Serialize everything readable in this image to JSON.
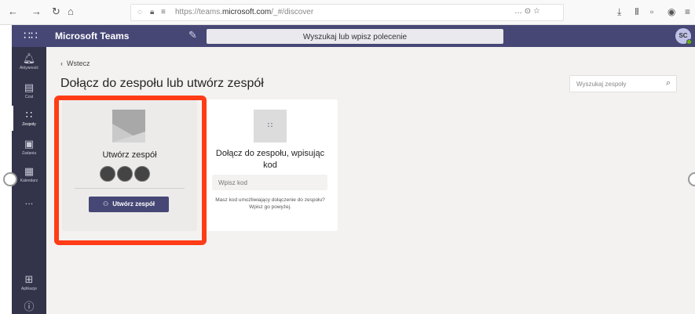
{
  "browser": {
    "url_prefix": "https://teams.",
    "url_domain": "microsoft.com",
    "url_suffix": "/_#/discover",
    "more_label": "… ⊙ ☆"
  },
  "header": {
    "app_name": "Microsoft Teams",
    "search_placeholder": "Wyszukaj lub wpisz polecenie",
    "avatar_initials": "SC"
  },
  "rail": {
    "items": [
      {
        "label": "Aktywność",
        "icon": "bell-icon"
      },
      {
        "label": "Czat",
        "icon": "chat-icon"
      },
      {
        "label": "Zespoły",
        "icon": "teams-icon"
      },
      {
        "label": "Zadania",
        "icon": "tasks-icon"
      },
      {
        "label": "Kalendarz",
        "icon": "calendar-icon"
      },
      {
        "label": "...",
        "icon": "more-icon"
      },
      {
        "label": "Aplikacje",
        "icon": "apps-icon"
      },
      {
        "label": "",
        "icon": "help-icon"
      }
    ]
  },
  "main": {
    "back_label": "Wstecz",
    "title": "Dołącz do zespołu lub utwórz zespół",
    "team_search_placeholder": "Wyszukaj zespoły",
    "create_card": {
      "title": "Utwórz zespół",
      "button_label": "Utwórz zespół"
    },
    "join_card": {
      "title": "Dołącz do zespołu, wpisując kod",
      "code_placeholder": "Wpisz kod",
      "help_text": "Masz kod umożliwiający dołączenie do zespołu? Wpisz go powyżej."
    }
  },
  "colors": {
    "teams_purple": "#464775",
    "rail_bg": "#33344a",
    "highlight": "#ff3c16"
  }
}
